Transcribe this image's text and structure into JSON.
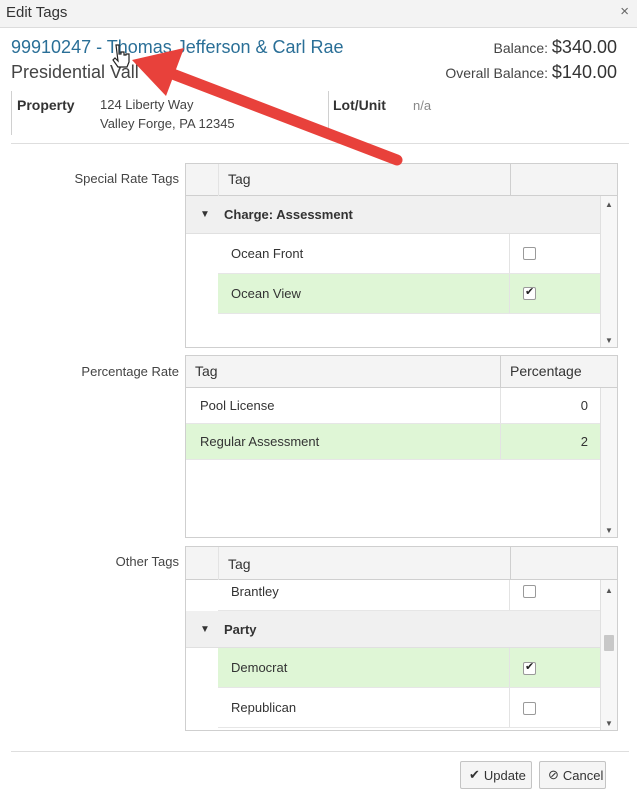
{
  "dialog": {
    "title": "Edit Tags",
    "close_glyph": "×"
  },
  "account": {
    "link": "99910247 - Thomas Jefferson & Carl Rae",
    "subtitle": "Presidential Vall",
    "balance_label": "Balance:",
    "balance_value": "$340.00",
    "overall_label": "Overall Balance:",
    "overall_value": "$140.00"
  },
  "property": {
    "label": "Property",
    "address_line1": "124 Liberty Way",
    "address_line2": "Valley Forge, PA 12345",
    "lot_label": "Lot/Unit",
    "lot_value": "n/a"
  },
  "special_rate": {
    "label": "Special Rate Tags",
    "col_tag": "Tag",
    "group": "Charge: Assessment",
    "rows": [
      {
        "name": "Ocean Front",
        "checked": false
      },
      {
        "name": "Ocean View",
        "checked": true
      }
    ]
  },
  "percentage_rate": {
    "label": "Percentage Rate",
    "col_tag": "Tag",
    "col_percentage": "Percentage",
    "rows": [
      {
        "name": "Pool License",
        "value": "0"
      },
      {
        "name": "Regular Assessment",
        "value": "2"
      }
    ]
  },
  "other_tags": {
    "label": "Other Tags",
    "col_tag": "Tag",
    "pre_rows": [
      {
        "name": "Brantley",
        "checked": false
      }
    ],
    "group": "Party",
    "rows": [
      {
        "name": "Democrat",
        "checked": true
      },
      {
        "name": "Republican",
        "checked": false
      }
    ]
  },
  "buttons": {
    "update_label": "Update",
    "cancel_label": "Cancel",
    "update_icon": "check-icon",
    "cancel_icon": "ban-icon"
  },
  "colors": {
    "link": "#2a6f97",
    "selected_row": "#dff6d6",
    "arrow": "#e8413b"
  }
}
